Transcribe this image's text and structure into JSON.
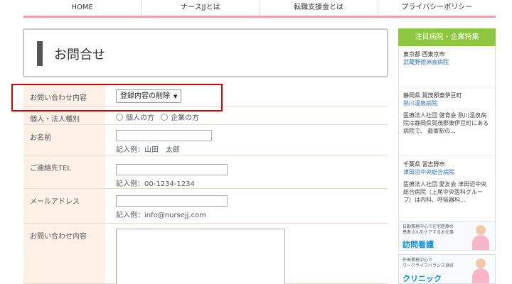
{
  "nav": [
    "HOME",
    "ナースJJとは",
    "転職支援金とは",
    "プライバシーポリシー"
  ],
  "title": "お問合せ",
  "form": {
    "inquiry_label": "お問い合わせ内容",
    "inquiry_select": "登録内容の削除",
    "type_label": "個人・法人種別",
    "type_options": [
      "個人の方",
      "企業の方"
    ],
    "name_label": "お名前",
    "name_example": "記入例：山田　太郎",
    "tel_label": "ご連絡先TEL",
    "tel_example": "記入例：00-1234-1234",
    "email_label": "メールアドレス",
    "email_example": "記入例：info@nursejj.com",
    "message_label": "お問い合わせ内容"
  },
  "sidebar": {
    "heading": "注目病院・企業特集",
    "entries": [
      {
        "location": "東京都 西東京市",
        "name": "武蔵野徳洲会病院",
        "desc": ""
      },
      {
        "location": "静岡県 賀茂郡東伊豆町",
        "name": "熱川温泉病院",
        "desc": "医療法人社団 健育会 熱川温泉病院は静岡県賀茂郡東伊豆町にある病院で、 最寄駅の..."
      },
      {
        "location": "千葉県 習志野市",
        "name": "津田沼中央総合病院",
        "desc": "医療法人社団 愛友会 津田沼中央総合病院（上尾中央医科グループ）は内科、呼吸器科..."
      }
    ]
  },
  "banners": [
    {
      "small": "日勤業務中心で在宅医療の\n患者さんをケアするお仕事",
      "big": "訪問看護"
    },
    {
      "small": "外来業務中心で\nワークライフバランス良好",
      "big": "クリニック"
    }
  ],
  "colors": {
    "nav_underline": "#f0a0a6",
    "label_bg": "#fdf0e6",
    "sidebar_head": "#8dc63f",
    "link": "#2a6ebb",
    "highlight": "#e00000"
  }
}
